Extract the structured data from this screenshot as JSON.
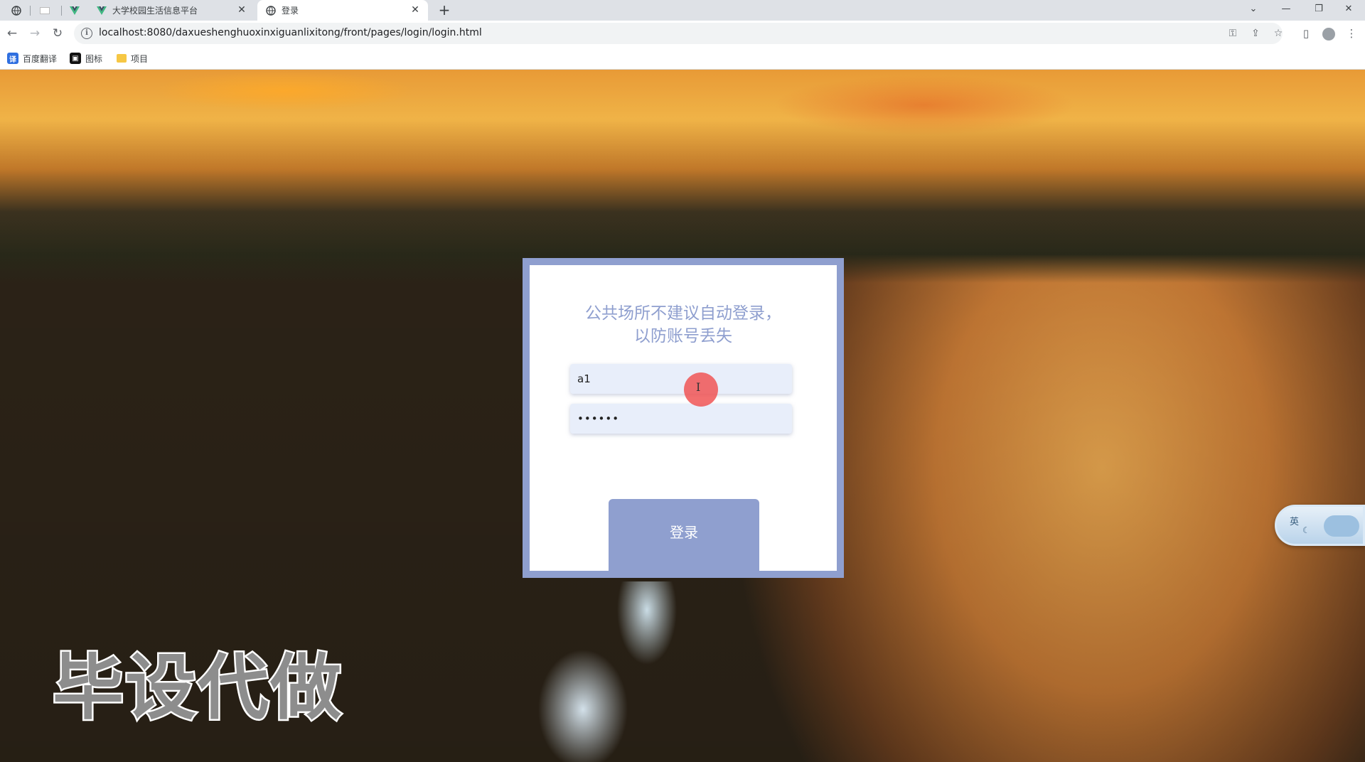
{
  "browser": {
    "tabs": [
      {
        "title": "",
        "active": false
      },
      {
        "title": "",
        "active": false
      },
      {
        "title": "",
        "active": false
      },
      {
        "title": "大学校园生活信息平台",
        "active": false
      },
      {
        "title": "登录",
        "active": true
      }
    ],
    "url": "localhost:8080/daxueshenghuoxinxiguanlixitong/front/pages/login/login.html",
    "bookmarks": [
      "百度翻译",
      "图标",
      "项目"
    ]
  },
  "login": {
    "notice_line1": "公共场所不建议自动登录，",
    "notice_line2": "以防账号丢失",
    "username_value": "a1",
    "password_value": "••••••",
    "submit_label": "登录"
  },
  "watermark": "毕设代做",
  "ime": {
    "lang": "英"
  },
  "colors": {
    "accent": "#8f9fcf",
    "input_bg": "#e8eefa",
    "cursor_highlight": "#f05555"
  }
}
